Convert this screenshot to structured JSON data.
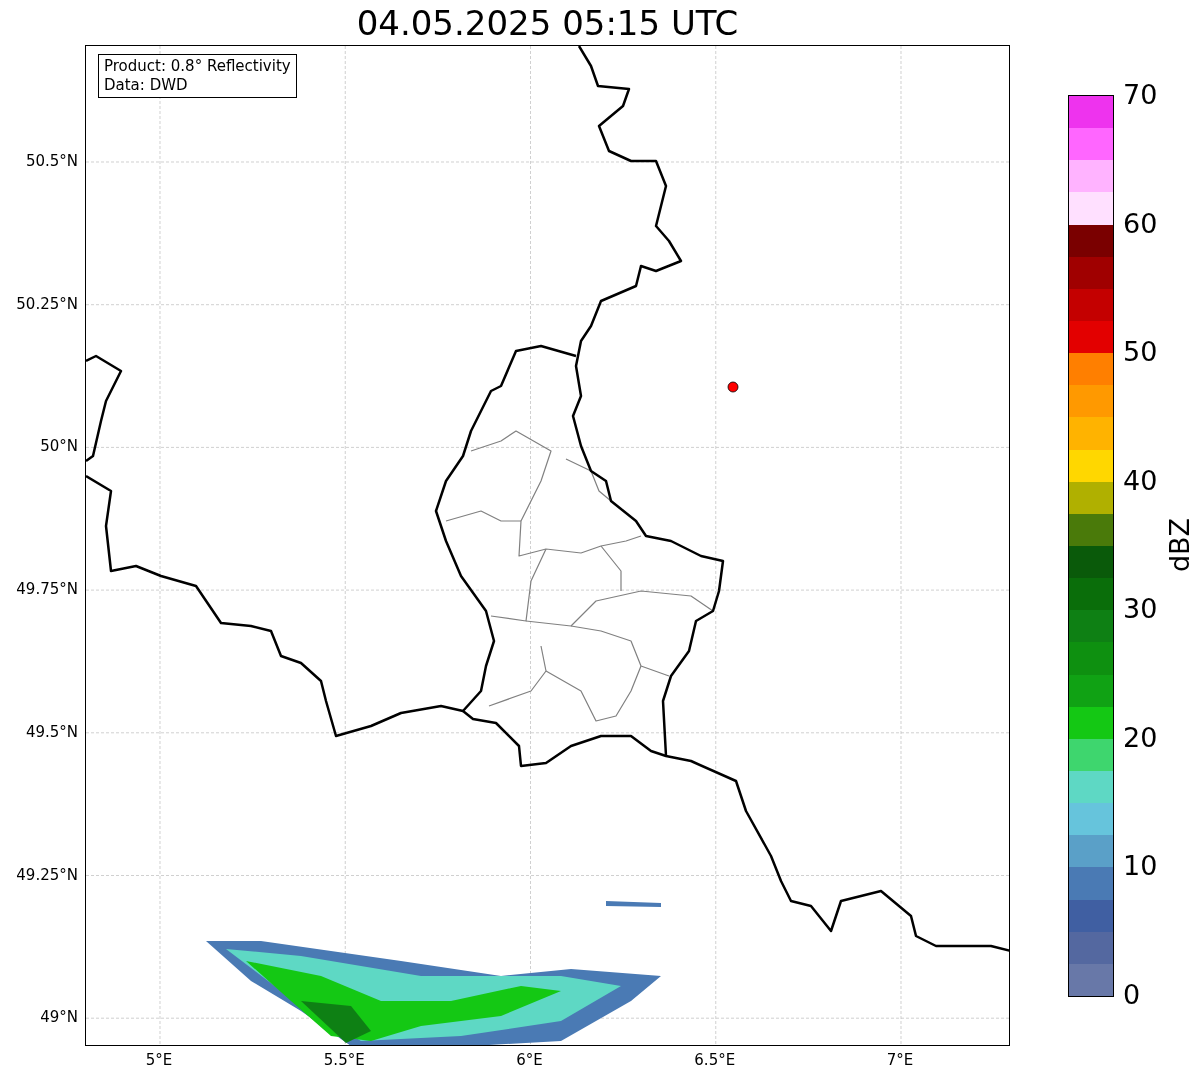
{
  "title": "04.05.2025 05:15 UTC",
  "info_box": [
    "Product: 0.8° Reflectivity",
    "Data: DWD"
  ],
  "y_ticks": [
    "50.5°N",
    "50.25°N",
    "50°N",
    "49.75°N",
    "49.5°N",
    "49.25°N",
    "49°N"
  ],
  "x_ticks": [
    "5°E",
    "5.5°E",
    "6°E",
    "6.5°E",
    "7°E"
  ],
  "colorbar": {
    "label": "dBZ",
    "ticks": [
      "70",
      "60",
      "50",
      "40",
      "30",
      "20",
      "10",
      "0"
    ],
    "bins": [
      {
        "color": "#ee33ee"
      },
      {
        "color": "#ff66ff"
      },
      {
        "color": "#ffb3ff"
      },
      {
        "color": "#ffe0ff"
      },
      {
        "color": "#7a0000"
      },
      {
        "color": "#a00000"
      },
      {
        "color": "#c40000"
      },
      {
        "color": "#e30000"
      },
      {
        "color": "#ff7f00"
      },
      {
        "color": "#ff9900"
      },
      {
        "color": "#ffb300"
      },
      {
        "color": "#ffd700"
      },
      {
        "color": "#b0b000"
      },
      {
        "color": "#4a7a0a"
      },
      {
        "color": "#0a5a0a"
      },
      {
        "color": "#0a6e0a"
      },
      {
        "color": "#0e8014"
      },
      {
        "color": "#0e9010"
      },
      {
        "color": "#10a214"
      },
      {
        "color": "#14c814"
      },
      {
        "color": "#3ed66e"
      },
      {
        "color": "#5ed8c4"
      },
      {
        "color": "#66c4dc"
      },
      {
        "color": "#5aa0c8"
      },
      {
        "color": "#4a7ab4"
      },
      {
        "color": "#405fa2"
      },
      {
        "color": "#5468a0"
      },
      {
        "color": "#6878a8"
      }
    ]
  }
}
